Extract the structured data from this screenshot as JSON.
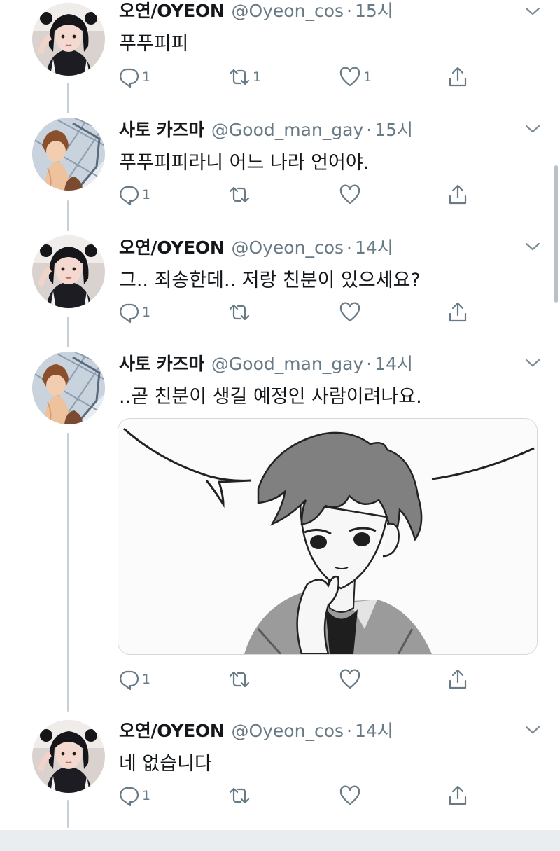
{
  "tweets": [
    {
      "name": "오연/OYEON",
      "handle": "@Oyeon_cos",
      "time": "15시",
      "text": "푸푸피피",
      "avatar": "oyeon",
      "reply_count": "1",
      "retweet_count": "1",
      "like_count": "1"
    },
    {
      "name": "사토 카즈마",
      "handle": "@Good_man_gay",
      "time": "15시",
      "text": "푸푸피피라니 어느 나라 언어야.",
      "avatar": "kazuma",
      "reply_count": "1",
      "retweet_count": "",
      "like_count": ""
    },
    {
      "name": "오연/OYEON",
      "handle": "@Oyeon_cos",
      "time": "14시",
      "text": "그.. 죄송한데.. 저랑 친분이 있으세요?",
      "avatar": "oyeon",
      "reply_count": "1",
      "retweet_count": "",
      "like_count": ""
    },
    {
      "name": "사토 카즈마",
      "handle": "@Good_man_gay",
      "time": "14시",
      "text": "..곧 친분이 생길 예정인 사람이려나요.",
      "avatar": "kazuma",
      "reply_count": "1",
      "retweet_count": "",
      "like_count": "",
      "has_media": true
    },
    {
      "name": "오연/OYEON",
      "handle": "@Oyeon_cos",
      "time": "14시",
      "text": "네 없습니다",
      "avatar": "oyeon",
      "reply_count": "1",
      "retweet_count": "",
      "like_count": ""
    }
  ],
  "separator": "·",
  "colors": {
    "meta_gray": "#687a86",
    "thread_line": "#c7d0d6",
    "text": "#14171a"
  }
}
